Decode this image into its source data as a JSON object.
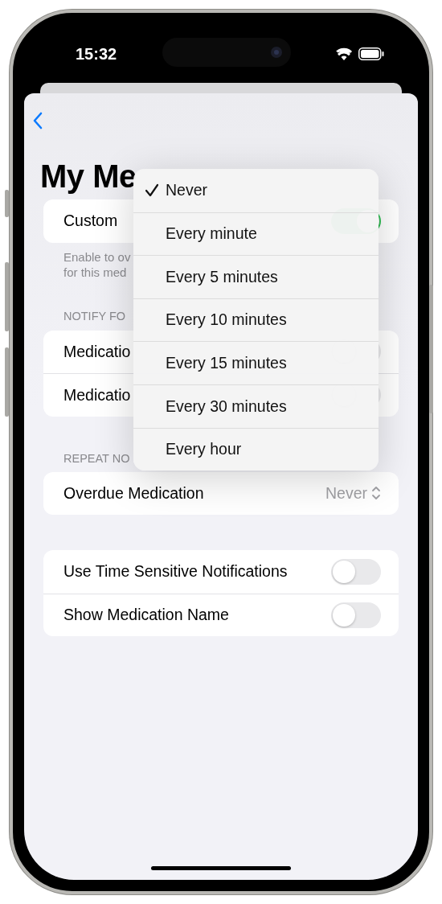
{
  "status_bar": {
    "time": "15:32"
  },
  "sheet": {
    "title": "My Me",
    "custom": {
      "label": "Custom",
      "on": true
    },
    "custom_footer": "Enable to ov\nfor this med",
    "notify_section": {
      "header": "NOTIFY FO",
      "rows": [
        {
          "label": "Medicatio",
          "on": false
        },
        {
          "label": "Medicatio",
          "on": false
        }
      ]
    },
    "repeat_section": {
      "header": "REPEAT NO",
      "rows": [
        {
          "label": "Overdue Medication",
          "value": "Never"
        }
      ]
    },
    "options_section": {
      "rows": [
        {
          "label": "Use Time Sensitive Notifications",
          "on": false
        },
        {
          "label": "Show Medication Name",
          "on": false
        }
      ]
    }
  },
  "menu": {
    "items": [
      {
        "label": "Never",
        "selected": true
      },
      {
        "label": "Every minute",
        "selected": false
      },
      {
        "label": "Every 5 minutes",
        "selected": false
      },
      {
        "label": "Every 10 minutes",
        "selected": false
      },
      {
        "label": "Every 15 minutes",
        "selected": false
      },
      {
        "label": "Every 30 minutes",
        "selected": false
      },
      {
        "label": "Every hour",
        "selected": false
      }
    ]
  }
}
